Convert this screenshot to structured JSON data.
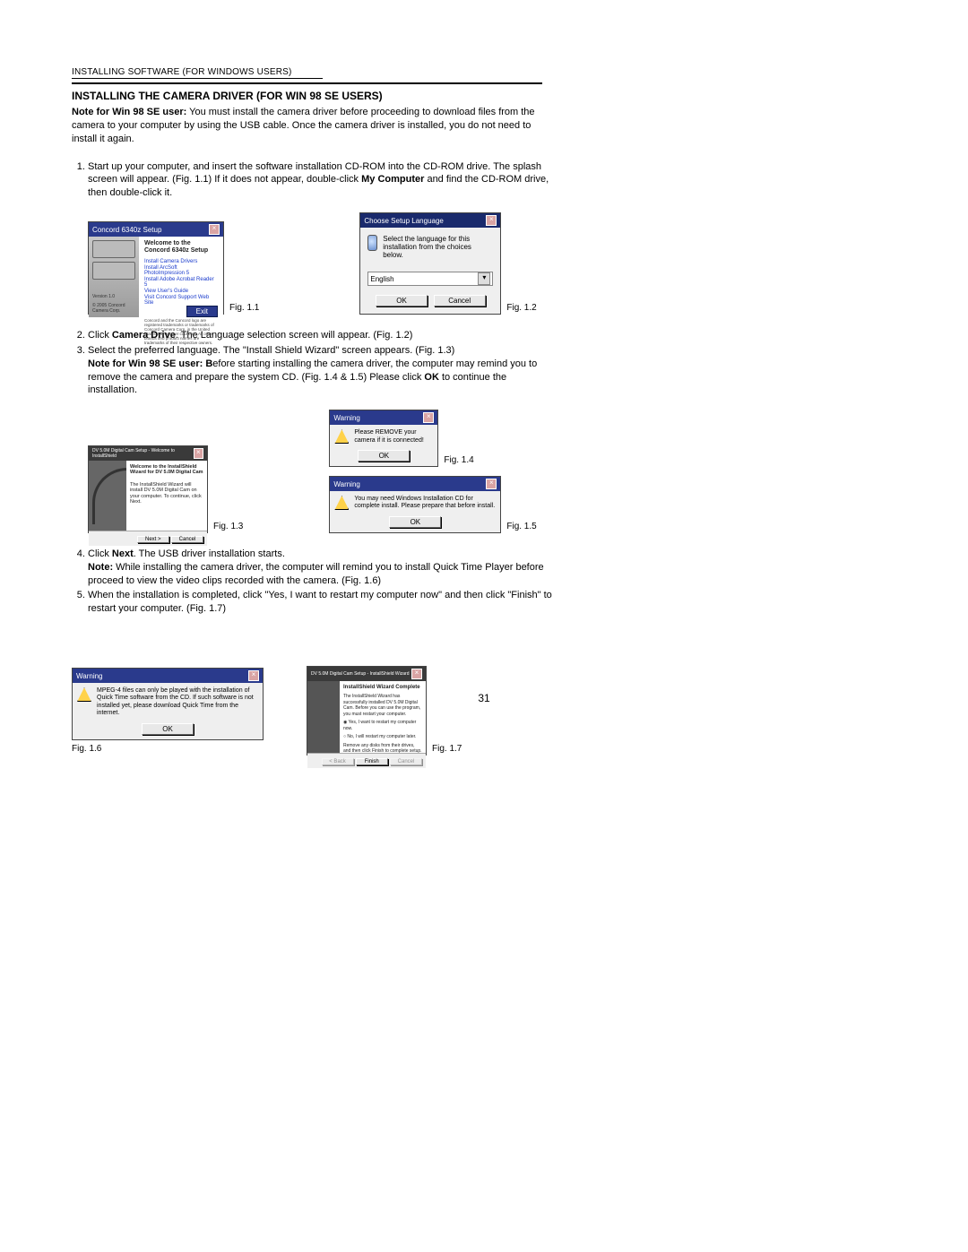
{
  "running_head": "INSTALLING SOFTWARE (FOR WINDOWS USERS)",
  "heading": "INSTALLING THE CAMERA DRIVER   (FOR WIN 98 SE USERS)",
  "intro_bold": "Note for Win 98 SE user:",
  "intro_rest": " You must install the camera driver before proceeding to download files from the camera to your computer by using the USB cable. Once the camera driver is installed, you do not need to install it again.",
  "step1_a": "Start up your computer, and insert the software installation CD-ROM into the CD-ROM drive. The splash screen will appear. (Fig. 1.1) If it does not appear, double-click ",
  "step1_b": "My Computer",
  "step1_c": " and find the CD-ROM drive, then double-click it.",
  "step2_a": "Click ",
  "step2_b": "Camera Drive",
  "step2_c": ". The Language selection screen will appear. (Fig. 1.2)",
  "step3_line1": "Select the preferred language. The \"Install Shield Wizard\" screen appears. (Fig. 1.3)",
  "step3_line2_b": "Note for Win 98 SE user: B",
  "step3_line2_rest": "efore starting installing the camera driver, the computer may remind you to remove the camera and prepare the system CD. (Fig. 1.4 & 1.5) Please click ",
  "step3_ok": "OK",
  "step3_tail": " to continue the installation.",
  "step4_a": "Click ",
  "step4_b": "Next",
  "step4_c": ". The USB driver installation starts.",
  "step4_note_b": "Note:",
  "step4_note_rest": " While installing the camera driver, the computer will remind you to install Quick Time Player before proceed to view the video clips recorded with the camera. (Fig. 1.6)",
  "step5": "When the installation is completed, click \"Yes, I want to restart my computer now\" and then click \"Finish\" to restart your computer. (Fig. 1.7)",
  "page_number": "31",
  "figcaps": {
    "f11": "Fig. 1.1",
    "f12": "Fig. 1.2",
    "f13": "Fig. 1.3",
    "f14": "Fig. 1.4",
    "f15": "Fig. 1.5",
    "f16": "Fig. 1.6",
    "f17": "Fig. 1.7"
  },
  "fig11": {
    "title": "Concord 6340z Setup",
    "welcome": "Welcome to the Concord 6340z Setup",
    "items": [
      "Install Camera Drivers",
      "Install ArcSoft PhotoImpression 5",
      "Install Adobe Acrobat Reader 5",
      "View User's Guide",
      "Visit Concord Support Web Site"
    ],
    "button": "Exit",
    "foot": "Concord and the Concord logo are registered trademarks or trademarks of Concord Camera Corp. in the United States and/or other countries. All other brands and product names are trademarks of their respective owners.",
    "footleft1": "Version 1.0",
    "footleft2": "© 2005 Concord Camera Corp."
  },
  "fig12": {
    "title": "Choose Setup Language",
    "msg": "Select the language for this installation from the choices below.",
    "select": "English",
    "ok": "OK",
    "cancel": "Cancel"
  },
  "fig13": {
    "title": "DV 5.0M Digital Cam Setup - Welcome to InstallShield",
    "h": "Welcome to the InstallShield Wizard for DV 5.0M Digital Cam",
    "p": "The InstallShield Wizard will install DV 5.0M Digital Cam on your computer. To continue, click Next.",
    "next": "Next >",
    "cancel": "Cancel"
  },
  "fig14": {
    "title": "Warning",
    "msg": "Please REMOVE your camera if it is connected!",
    "ok": "OK"
  },
  "fig15": {
    "title": "Warning",
    "msg": "You may need Windows Installation CD for complete install. Please prepare that before install.",
    "ok": "OK"
  },
  "fig16": {
    "title": "Warning",
    "msg": "MPEG-4 files can only be played with the installation of Quick Time software from the CD. If such software is not installed yet, please download Quick Time from the internet.",
    "ok": "OK"
  },
  "fig17": {
    "title": "DV 5.0M Digital Cam Setup - InstallShield Wizard",
    "h": "InstallShield Wizard Complete",
    "p": "The InstallShield Wizard has successfully installed DV 5.0M Digital Cam. Before you can use the program, you must restart your computer.",
    "opt1": "Yes, I want to restart my computer now.",
    "opt2": "No, I will restart my computer later.",
    "p2": "Remove any disks from their drives, and then click Finish to complete setup.",
    "back": "< Back",
    "finish": "Finish",
    "cancel": "Cancel"
  }
}
